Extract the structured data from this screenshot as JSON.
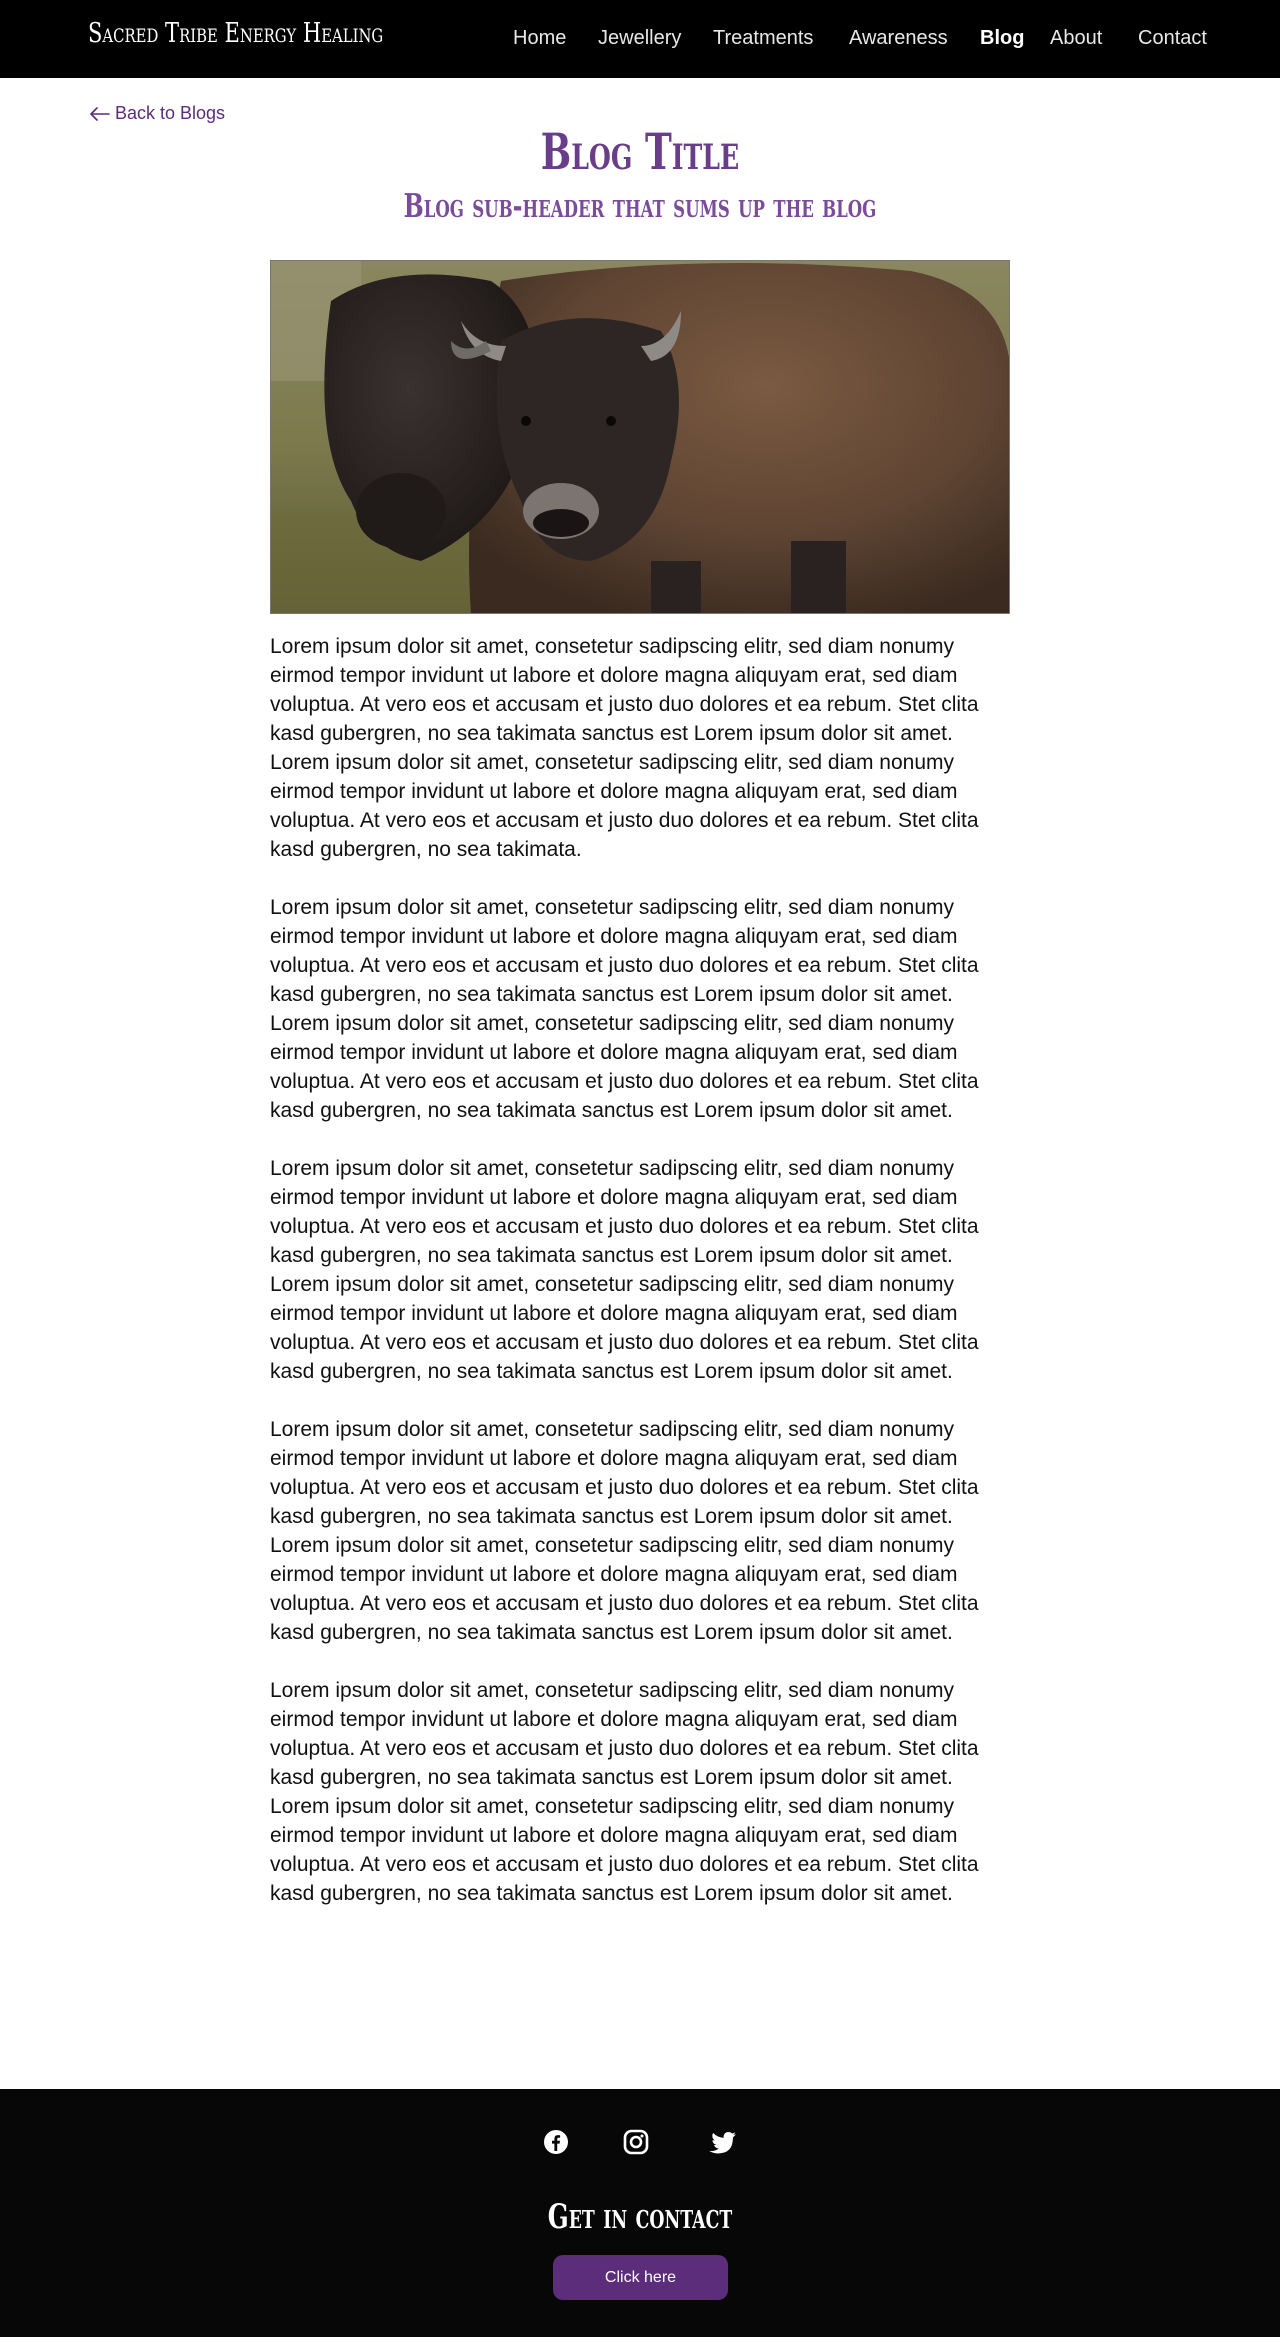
{
  "site": {
    "brand": "Sacred Tribe Energy Healing",
    "accent_color": "#5b2d7a"
  },
  "nav": {
    "items": [
      {
        "label": "Home",
        "active": false
      },
      {
        "label": "Jewellery",
        "active": false
      },
      {
        "label": "Treatments",
        "active": false
      },
      {
        "label": "Awareness",
        "active": false
      },
      {
        "label": "Blog",
        "active": true
      },
      {
        "label": "About",
        "active": false
      },
      {
        "label": "Contact",
        "active": false
      }
    ]
  },
  "back_link": {
    "label": "Back to Blogs",
    "icon": "arrow-left-icon"
  },
  "post": {
    "title": "Blog Title",
    "subtitle": "Blog sub-header that sums up the blog",
    "image_icon": "bison-photo",
    "paragraphs": [
      "Lorem ipsum dolor sit amet, consetetur sadipscing elitr, sed diam nonumy eirmod tempor invidunt ut labore et dolore magna aliquyam erat, sed diam voluptua. At vero eos et accusam et justo duo dolores et ea rebum. Stet clita kasd gubergren, no sea takimata sanctus est Lorem ipsum dolor sit amet. Lorem ipsum dolor sit amet, consetetur sadipscing elitr, sed diam nonumy eirmod tempor invidunt ut labore et dolore magna aliquyam erat, sed diam voluptua. At vero eos et accusam et justo duo dolores et ea rebum. Stet clita kasd gubergren, no sea takimata.",
      "Lorem ipsum dolor sit amet, consetetur sadipscing elitr, sed diam nonumy eirmod tempor invidunt ut labore et dolore magna aliquyam erat, sed diam voluptua. At vero eos et accusam et justo duo dolores et ea rebum. Stet clita kasd gubergren, no sea takimata sanctus est Lorem ipsum dolor sit amet. Lorem ipsum dolor sit amet, consetetur sadipscing elitr, sed diam nonumy eirmod tempor invidunt ut labore et dolore magna aliquyam erat, sed diam voluptua. At vero eos et accusam et justo duo dolores et ea rebum. Stet clita kasd gubergren, no sea takimata sanctus est Lorem ipsum dolor sit amet.",
      "Lorem ipsum dolor sit amet, consetetur sadipscing elitr, sed diam nonumy eirmod tempor invidunt ut labore et dolore magna aliquyam erat, sed diam voluptua. At vero eos et accusam et justo duo dolores et ea rebum. Stet clita kasd gubergren, no sea takimata sanctus est Lorem ipsum dolor sit amet. Lorem ipsum dolor sit amet, consetetur sadipscing elitr, sed diam nonumy eirmod tempor invidunt ut labore et dolore magna aliquyam erat, sed diam voluptua. At vero eos et accusam et justo duo dolores et ea rebum. Stet clita kasd gubergren, no sea takimata sanctus est Lorem ipsum dolor sit amet.",
      "Lorem ipsum dolor sit amet, consetetur sadipscing elitr, sed diam nonumy eirmod tempor invidunt ut labore et dolore magna aliquyam erat, sed diam voluptua. At vero eos et accusam et justo duo dolores et ea rebum. Stet clita kasd gubergren, no sea takimata sanctus est Lorem ipsum dolor sit amet. Lorem ipsum dolor sit amet, consetetur sadipscing elitr, sed diam nonumy eirmod tempor invidunt ut labore et dolore magna aliquyam erat, sed diam voluptua. At vero eos et accusam et justo duo dolores et ea rebum. Stet clita kasd gubergren, no sea takimata sanctus est Lorem ipsum dolor sit amet.",
      "Lorem ipsum dolor sit amet, consetetur sadipscing elitr, sed diam nonumy eirmod tempor invidunt ut labore et dolore magna aliquyam erat, sed diam voluptua. At vero eos et accusam et justo duo dolores et ea rebum. Stet clita kasd gubergren, no sea takimata sanctus est Lorem ipsum dolor sit amet. Lorem ipsum dolor sit amet, consetetur sadipscing elitr, sed diam nonumy eirmod tempor invidunt ut labore et dolore magna aliquyam erat, sed diam voluptua. At vero eos et accusam et justo duo dolores et ea rebum. Stet clita kasd gubergren, no sea takimata sanctus est Lorem ipsum dolor sit amet."
    ]
  },
  "footer": {
    "social": [
      {
        "icon": "facebook-icon"
      },
      {
        "icon": "instagram-icon"
      },
      {
        "icon": "twitter-icon"
      }
    ],
    "heading": "Get in contact",
    "button_label": "Click here"
  }
}
